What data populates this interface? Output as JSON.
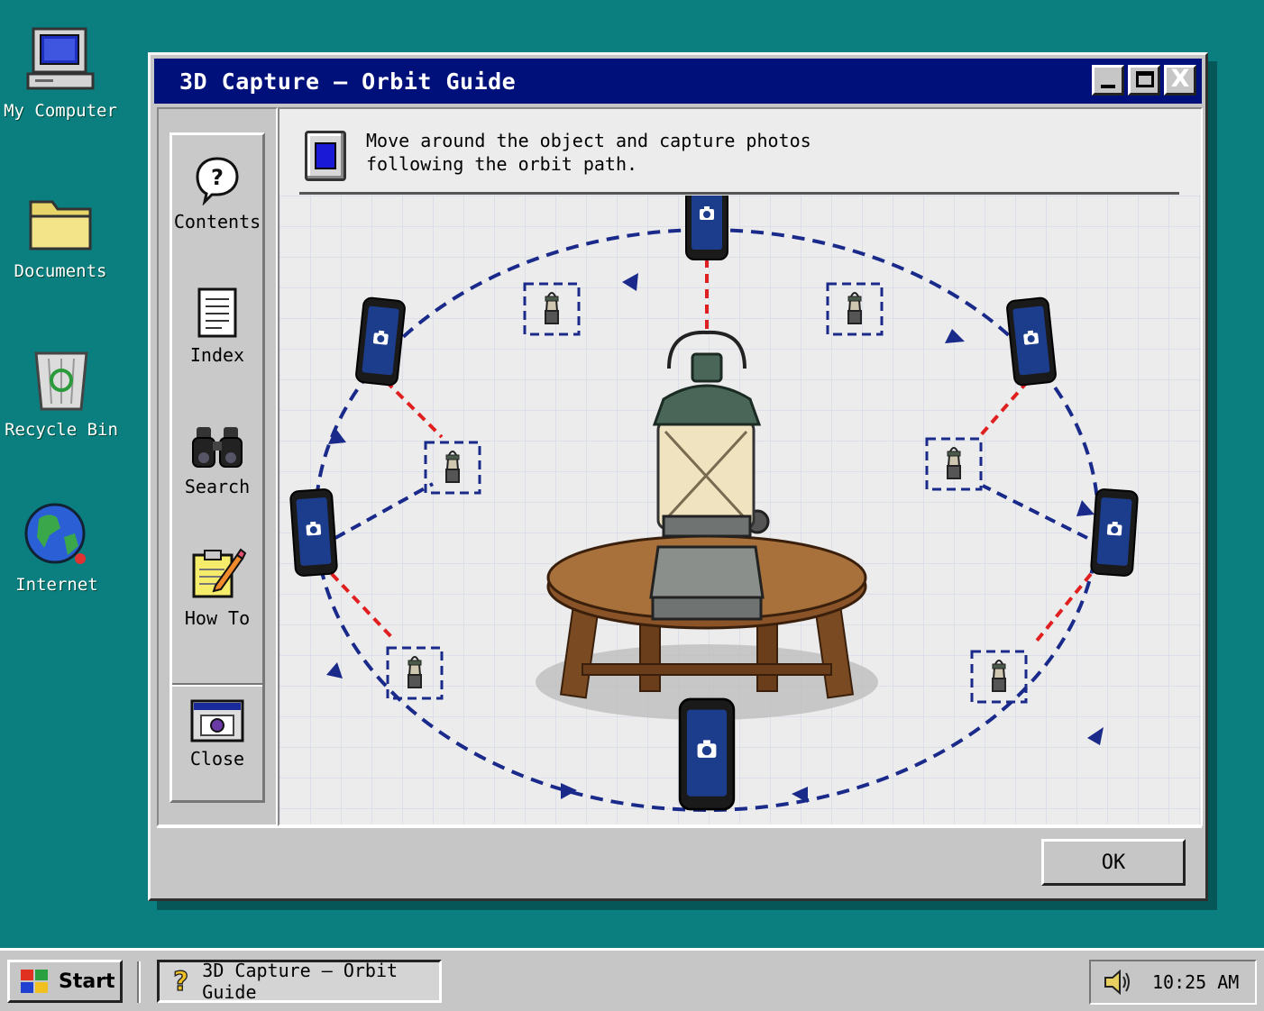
{
  "desktop": {
    "icons": [
      {
        "label": "My Computer"
      },
      {
        "label": "Documents"
      },
      {
        "label": "Recycle Bin"
      },
      {
        "label": "Internet"
      }
    ]
  },
  "window": {
    "title": "3D Capture — Orbit Guide",
    "controls": {
      "close_glyph": "X"
    },
    "sidebar": {
      "items": [
        {
          "label": "Contents",
          "icon": "help-bubble-icon"
        },
        {
          "label": "Index",
          "icon": "document-icon"
        },
        {
          "label": "Search",
          "icon": "binoculars-icon"
        },
        {
          "label": "How To",
          "icon": "notepad-pencil-icon"
        },
        {
          "label": "Close",
          "icon": "window-icon"
        }
      ]
    },
    "instruction": "Move around the object and capture photos\nfollowing the orbit path.",
    "ok_label": "OK"
  },
  "colors": {
    "desktop": "#0b7f7f",
    "titlebar": "#00107a",
    "orbit_path": "#1a2a8a",
    "sightline": "#e02020",
    "phone_screen": "#1c3c8c"
  },
  "taskbar": {
    "start_label": "Start",
    "task_label": "3D Capture — Orbit Guide",
    "clock": "10:25 AM"
  }
}
